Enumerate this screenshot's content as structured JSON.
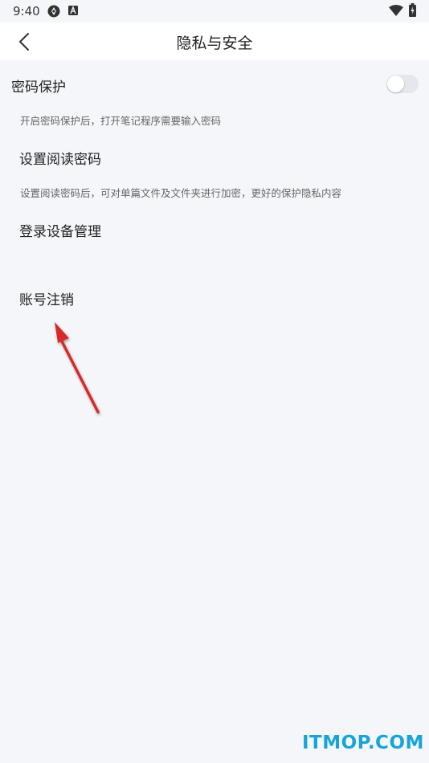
{
  "status_bar": {
    "time": "9:40",
    "icons": [
      "sync-icon",
      "a-letter-icon",
      "wifi-icon",
      "battery-charging-icon"
    ]
  },
  "nav": {
    "title": "隐私与安全",
    "back_icon": "chevron-left-icon"
  },
  "settings": {
    "password_protection": {
      "label": "密码保护",
      "description": "开启密码保护后，打开笔记程序需要输入密码",
      "enabled": false
    },
    "read_password": {
      "label": "设置阅读密码",
      "description": "设置阅读密码后，可对单篇文件及文件夹进行加密，更好的保护隐私内容"
    },
    "device_management": {
      "label": "登录设备管理"
    },
    "account_cancel": {
      "label": "账号注销"
    }
  },
  "annotation": {
    "arrow_color": "#d62a2a"
  },
  "watermark": {
    "text": "ITMOP.COM",
    "color": "#19a4d8"
  },
  "colors": {
    "background": "#f5f6fa",
    "toggle_off": "#e6e7ec"
  }
}
